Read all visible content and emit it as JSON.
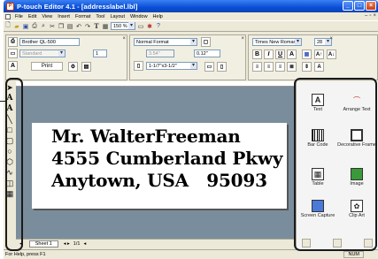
{
  "window": {
    "title": "P-touch Editor 4.1 - [addresslabel.lbl]",
    "buttons": [
      "_",
      "□",
      "×"
    ]
  },
  "menu": {
    "items": [
      "File",
      "Edit",
      "View",
      "Insert",
      "Format",
      "Tool",
      "Layout",
      "Window",
      "Help"
    ]
  },
  "toolbar": {
    "zoom": "150 %"
  },
  "properties": {
    "printer": "Brother QL-500",
    "media_size": "Standard",
    "copies": "1",
    "print_label": "Print",
    "format": "Normal Format",
    "length": "3.54\"",
    "margin": "0.12\"",
    "label_size": "1-1/7\"x3-1/2\"",
    "font": "Times New Roman",
    "font_size": "28",
    "style_buttons": [
      "B",
      "I",
      "U",
      "A"
    ]
  },
  "label": {
    "lines": [
      "Mr. WalterFreeman",
      "4555 Cumberland Pkwy",
      "Anytown, USA   95093"
    ]
  },
  "sheets": {
    "tab": "Sheet 1",
    "page": "1/1"
  },
  "object_panel": {
    "items": [
      {
        "label": "Text",
        "icon": "text-icon"
      },
      {
        "label": "Arrange Text",
        "icon": "arrange-text-icon"
      },
      {
        "label": "Bar Code",
        "icon": "barcode-icon"
      },
      {
        "label": "Decorative Frame",
        "icon": "frame-icon"
      },
      {
        "label": "Table",
        "icon": "table-icon"
      },
      {
        "label": "Image",
        "icon": "image-icon"
      },
      {
        "label": "Screen Capture",
        "icon": "screen-capture-icon"
      },
      {
        "label": "Clip Art",
        "icon": "clip-art-icon"
      }
    ]
  },
  "status": {
    "help_text": "For Help, press F1",
    "num": "NUM"
  }
}
